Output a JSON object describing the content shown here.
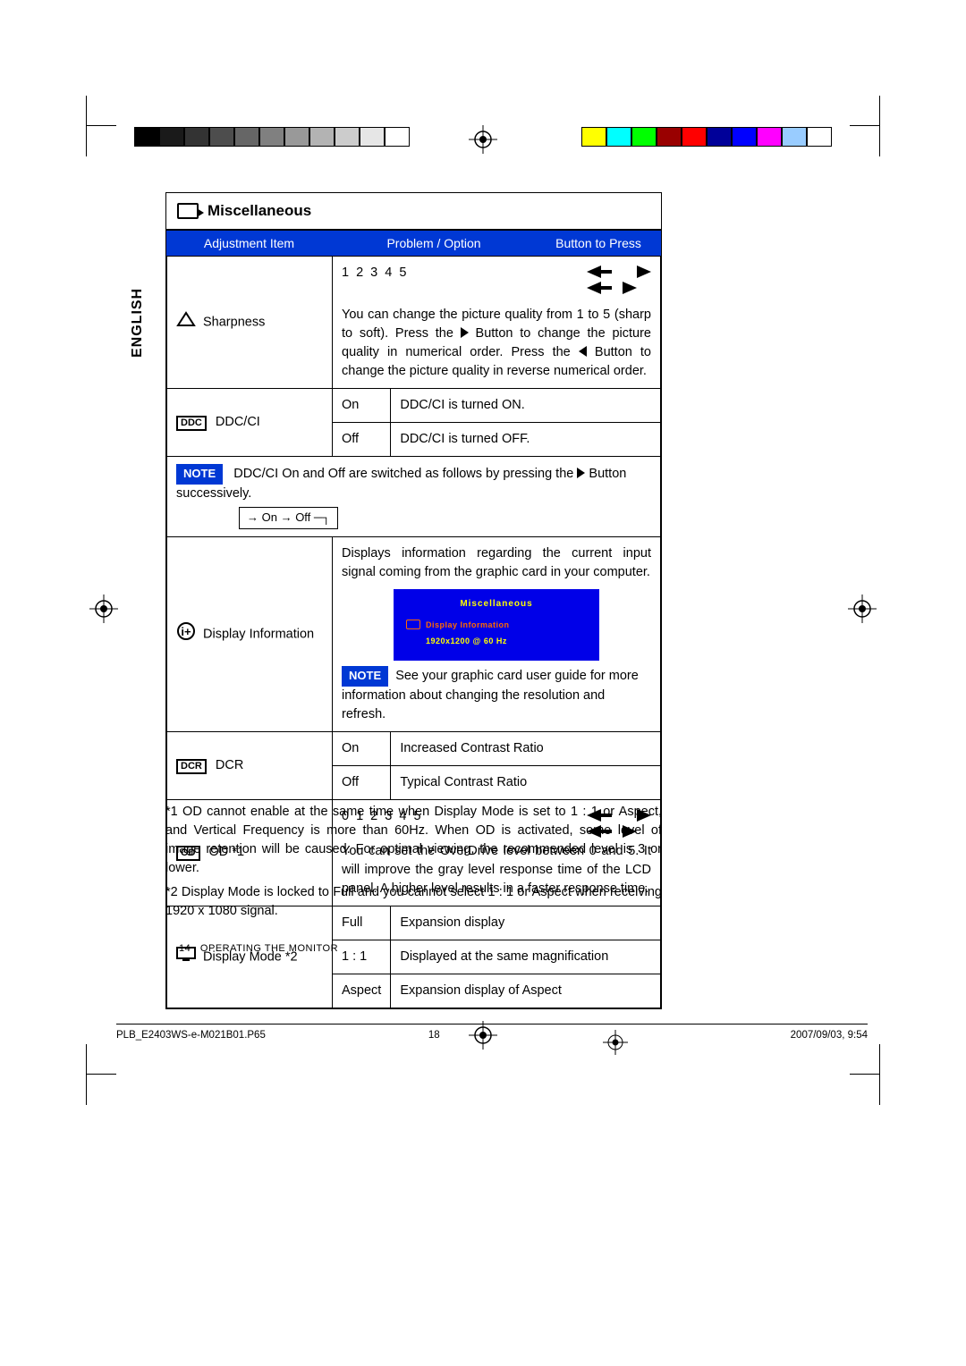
{
  "lang_tab": "ENGLISH",
  "section_title": "Miscellaneous",
  "columns": {
    "c1": "Adjustment Item",
    "c2": "Problem / Option",
    "c3": "Button to Press"
  },
  "sharpness": {
    "label": "Sharpness",
    "levels": "1 2 3 4 5",
    "desc_a": "You can change the picture quality from 1 to 5 (sharp to soft). Press the ",
    "desc_b": " Button to change the picture quality in numerical order. Press the ",
    "desc_c": " Button to change the picture quality in reverse numerical order."
  },
  "ddcci": {
    "label": "DDC/CI",
    "on": "On",
    "on_desc": "DDC/CI is turned ON.",
    "off": "Off",
    "off_desc": "DDC/CI is turned OFF.",
    "note_label": "NOTE",
    "note_a": "DDC/CI On and Off are switched as follows by pressing the ",
    "note_b": " Button successively.",
    "cycle": "On → Off"
  },
  "dispinfo": {
    "label": "Display Information",
    "desc": "Displays information regarding the current input signal coming from the graphic card in your computer.",
    "osd_title": "Miscellaneous",
    "osd_line": "Display Information",
    "osd_res": "1920x1200   @  60 Hz",
    "note_label": "NOTE",
    "note": "See your graphic card user guide for more information about changing the resolution and refresh."
  },
  "dcr": {
    "label": "DCR",
    "on": "On",
    "on_desc": "Increased Contrast Ratio",
    "off": "Off",
    "off_desc": "Typical Contrast Ratio"
  },
  "od": {
    "label": "OD *1",
    "levels": "0 1 2 3 4 5",
    "desc": "You can set the OverDrive level between 0 and 5. It will improve the gray level response time of the LCD panel. A higher level results in a faster response time."
  },
  "dispmode": {
    "label": "Display Mode *2",
    "full": "Full",
    "full_desc": "Expansion display",
    "one": "1 : 1",
    "one_desc": "Displayed at the same magnification",
    "aspect": "Aspect",
    "aspect_desc": "Expansion display of Aspect"
  },
  "footnotes": {
    "f1": "*1 OD cannot enable at the same time when Display Mode is set to 1 : 1 or Aspect, and Vertical Frequency is more than 60Hz. When OD is activated, some level of image retention will be caused. For optimal viewing, the recommended level is 3 or lower.",
    "f2": "*2 Display Mode is locked to Full and you cannot select 1 : 1 or Aspect when receiving 1920 x 1080 signal."
  },
  "page_footer": {
    "num": "14",
    "title": "OPERATING THE MONITOR"
  },
  "imprint": {
    "file": "PLB_E2403WS-e-M021B01.P65",
    "page": "18",
    "date": "2007/09/03, 9:54"
  }
}
